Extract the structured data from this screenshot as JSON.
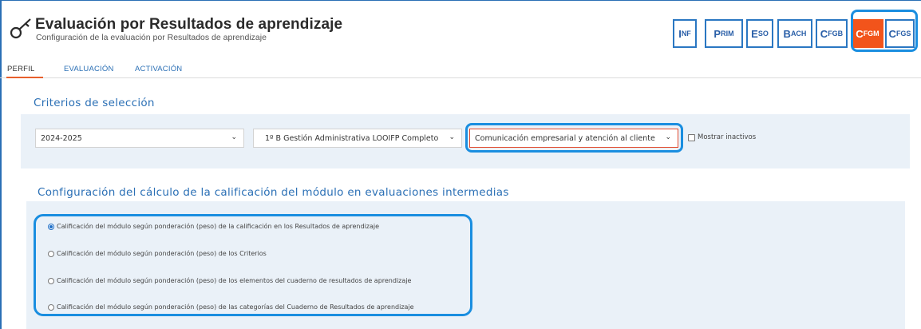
{
  "header": {
    "title": "Evaluación por Resultados de aprendizaje",
    "subtitle": "Configuración de la evaluación por Resultados de aprendizaje"
  },
  "levels": [
    {
      "big": "I",
      "small": "NF",
      "active": false
    },
    {
      "big": "P",
      "small": "RIM",
      "active": false
    },
    {
      "big": "E",
      "small": "SO",
      "active": false
    },
    {
      "big": "B",
      "small": "ACH",
      "active": false
    },
    {
      "big": "C",
      "small": "FGB",
      "active": false
    },
    {
      "big": "C",
      "small": "FGM",
      "active": true
    },
    {
      "big": "C",
      "small": "FGS",
      "active": false
    }
  ],
  "tabs": {
    "perfil": "PERFIL",
    "evaluacion": "EVALUACIÓN",
    "activacion": "ACTIVACIÓN"
  },
  "criteria": {
    "title": "Criterios de selección",
    "year": "2024-2025",
    "group": "1º B Gestión Administrativa LOOIFP Completo",
    "module": "Comunicación empresarial y atención al cliente",
    "show_inactive": "Mostrar inactivos"
  },
  "config": {
    "title": "Configuración del cálculo de la calificación del módulo en evaluaciones intermedias",
    "options": [
      "Calificación del módulo según ponderación (peso) de la calificación en los Resultados de aprendizaje",
      "Calificación del módulo según ponderación (peso) de los Criterios",
      "Calificación del módulo según ponderación (peso) de los elementos del cuaderno de resultados de aprendizaje",
      "Calificación del módulo según ponderación (peso) de las categorías del Cuaderno de Resultados de aprendizaje"
    ]
  },
  "colors": {
    "accent": "#2a6fb5",
    "active_level": "#f2541b",
    "highlight": "#1a8ee0",
    "panel": "#eaf1f8"
  }
}
